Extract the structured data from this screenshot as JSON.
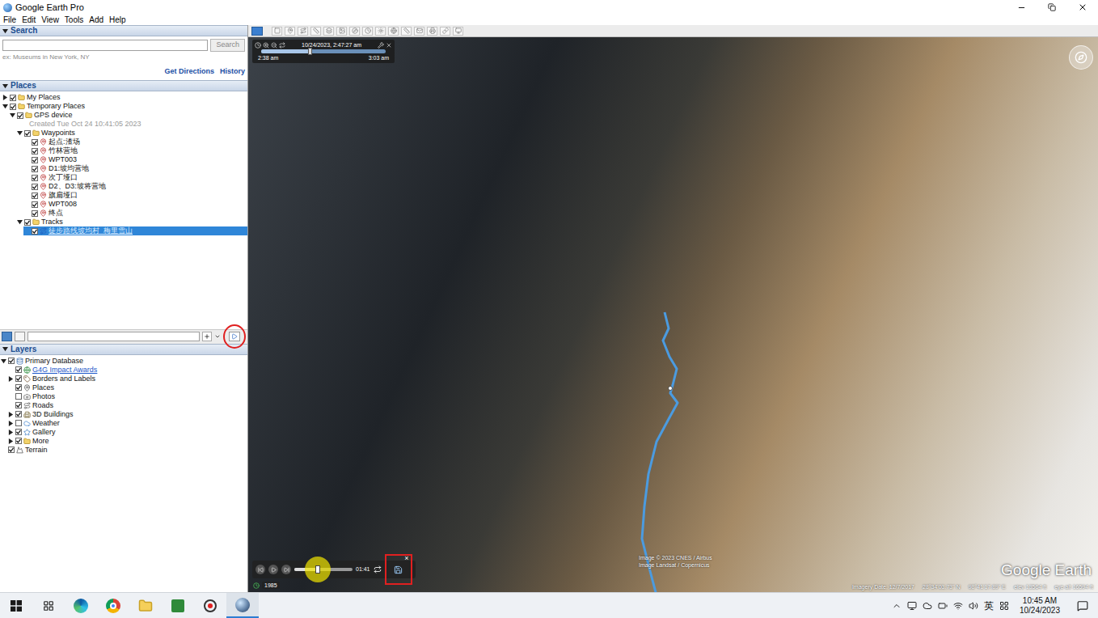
{
  "window": {
    "title": "Google Earth Pro"
  },
  "menu": [
    "File",
    "Edit",
    "View",
    "Tools",
    "Add",
    "Help"
  ],
  "search": {
    "header": "Search",
    "expanded": true,
    "button": "Search",
    "hint": "ex: Museums in New York, NY",
    "links": [
      "Get Directions",
      "History"
    ]
  },
  "places": {
    "header": "Places",
    "expanded": true,
    "items": [
      {
        "label": "My Places",
        "kind": "folder",
        "checked": true,
        "expanded": false,
        "selected": false
      },
      {
        "label": "Temporary Places",
        "kind": "folder",
        "checked": true,
        "expanded": true,
        "selected": false,
        "children": [
          {
            "label": "GPS device",
            "kind": "folder",
            "checked": true,
            "expanded": true,
            "selected": false,
            "children": [
              {
                "label": "Created Tue Oct 24 10:41:05 2023",
                "kind": "note",
                "selected": false
              },
              {
                "label": "Waypoints",
                "kind": "folder",
                "checked": true,
                "expanded": true,
                "selected": false,
                "children": [
                  {
                    "label": "起点:渣场",
                    "kind": "waypoint",
                    "checked": true,
                    "selected": false
                  },
                  {
                    "label": "竹林营地",
                    "kind": "waypoint",
                    "checked": true,
                    "selected": false
                  },
                  {
                    "label": "WPT003",
                    "kind": "waypoint",
                    "checked": true,
                    "selected": false
                  },
                  {
                    "label": "D1:坡均营地",
                    "kind": "waypoint",
                    "checked": true,
                    "selected": false
                  },
                  {
                    "label": "次丁垭口",
                    "kind": "waypoint",
                    "checked": true,
                    "selected": false
                  },
                  {
                    "label": "D2、D3:坡将营地",
                    "kind": "waypoint",
                    "checked": true,
                    "selected": false
                  },
                  {
                    "label": "旗扁垭口",
                    "kind": "waypoint",
                    "checked": true,
                    "selected": false
                  },
                  {
                    "label": "WPT008",
                    "kind": "waypoint",
                    "checked": true,
                    "selected": false
                  },
                  {
                    "label": "终点",
                    "kind": "waypoint",
                    "checked": true,
                    "selected": false
                  }
                ]
              },
              {
                "label": "Tracks",
                "kind": "folder",
                "checked": true,
                "expanded": true,
                "selected": false,
                "children": [
                  {
                    "label": "徒步路线坡均村_梅里雪山",
                    "kind": "track",
                    "checked": true,
                    "selected": true
                  }
                ]
              }
            ]
          }
        ]
      }
    ]
  },
  "layers": {
    "header": "Layers",
    "expanded": true,
    "items": [
      {
        "label": "Primary Database",
        "kind": "database",
        "checked": true,
        "expanded": true,
        "selected": false,
        "children": [
          {
            "label": "G4G Impact Awards",
            "kind": "link",
            "checked": true,
            "selected": false
          },
          {
            "label": "Borders and Labels",
            "kind": "borders",
            "checked": true,
            "expanded": false,
            "selected": false
          },
          {
            "label": "Places",
            "kind": "places",
            "checked": true,
            "selected": false
          },
          {
            "label": "Photos",
            "kind": "photos",
            "checked": false,
            "selected": false
          },
          {
            "label": "Roads",
            "kind": "roads",
            "checked": true,
            "selected": false
          },
          {
            "label": "3D Buildings",
            "kind": "buildings",
            "checked": true,
            "expanded": false,
            "selected": false
          },
          {
            "label": "Weather",
            "kind": "weather",
            "checked": false,
            "expanded": false,
            "selected": false
          },
          {
            "label": "Gallery",
            "kind": "gallery",
            "checked": true,
            "expanded": false,
            "selected": false
          },
          {
            "label": "More",
            "kind": "more",
            "checked": true,
            "expanded": false,
            "selected": false
          }
        ]
      },
      {
        "label": "Terrain",
        "kind": "terrain",
        "checked": true,
        "selected": false
      }
    ]
  },
  "time_slider": {
    "date": "10/24/2023, 2:47:27 am",
    "start": "2:38 am",
    "end": "3:03 am",
    "level": 0.39
  },
  "tour": {
    "time": "01:41",
    "level": 0.4,
    "close": "×"
  },
  "year_badge": "1985",
  "map": {
    "attribution": [
      "Image © 2023 CNES / Airbus",
      "Image Landsat / Copernicus"
    ],
    "logo": "Google Earth"
  },
  "status_bar": {
    "imagery_date": "Imagery Date: 12/7/2017",
    "lat": "28°34'03.73\" N",
    "lon": "98°41'17.89\" E",
    "elev": "elev 13564 ft",
    "eye_alt": "eye alt 16594 ft"
  },
  "taskbar": {
    "ime": "英",
    "time": "10:45 AM",
    "date": "10/24/2023"
  }
}
